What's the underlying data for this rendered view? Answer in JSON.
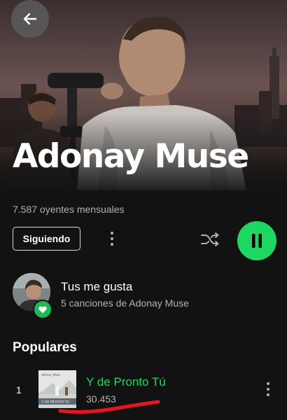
{
  "header": {
    "back_icon": "arrow-left-icon",
    "artist_name": "Adonay Muse"
  },
  "stats": {
    "monthly_listeners": "7.587 oyentes mensuales"
  },
  "actions": {
    "follow_label": "Siguiendo",
    "more_icon": "more-vertical-icon",
    "shuffle_icon": "shuffle-icon",
    "play_state_icon": "pause-icon"
  },
  "liked_songs": {
    "title": "Tus me gusta",
    "subtitle": "5 canciones de Adonay Muse",
    "badge_icon": "heart-icon"
  },
  "popular": {
    "heading": "Populares",
    "tracks": [
      {
        "rank": "1",
        "title": "Y de Pronto Tú",
        "plays": "30.453",
        "cover_text_top": "Adonay Muse",
        "cover_text_bottom": "Y DE PRONTO TU"
      }
    ]
  },
  "colors": {
    "background": "#121212",
    "accent_green": "#1ed760",
    "secondary_text": "#b3b3b3",
    "annotation_red": "#e8161c"
  }
}
